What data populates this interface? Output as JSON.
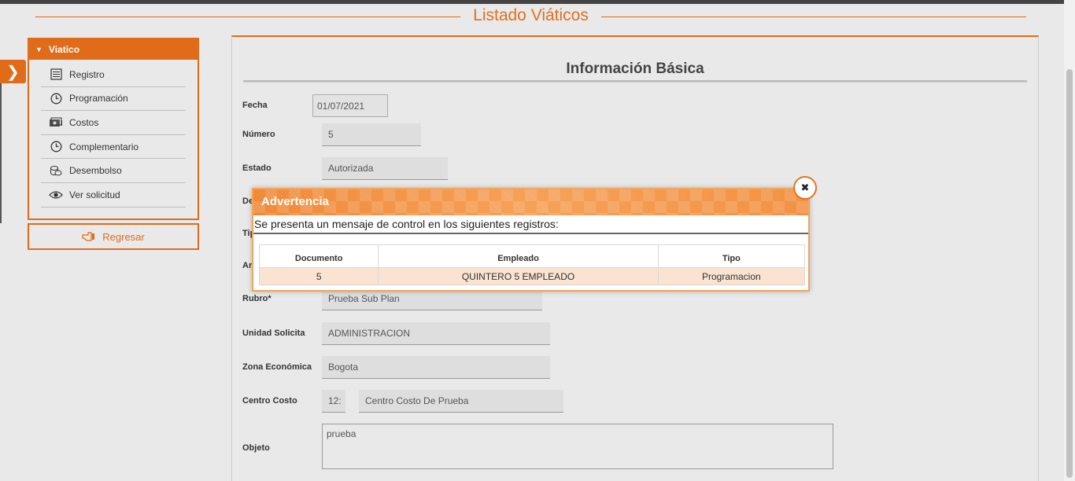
{
  "page": {
    "title": "Listado Viáticos"
  },
  "sidebar": {
    "header": "Viatico",
    "items": [
      {
        "label": "Registro",
        "icon": "list-icon"
      },
      {
        "label": "Programación",
        "icon": "clock-icon"
      },
      {
        "label": "Costos",
        "icon": "money-icon"
      },
      {
        "label": "Complementario",
        "icon": "clock-icon"
      },
      {
        "label": "Desembolso",
        "icon": "coins-icon"
      },
      {
        "label": "Ver solicitud",
        "icon": "eye-icon"
      }
    ],
    "back_label": "Regresar"
  },
  "form": {
    "section_title": "Información Básica",
    "fecha_label": "Fecha",
    "fecha_value": "01/07/2021",
    "numero_label": "Número",
    "numero_value": "5",
    "estado_label": "Estado",
    "estado_value": "Autorizada",
    "de_label_partial": "De",
    "ti_label_partial": "Tip",
    "ar_label_partial": "Ar",
    "rubro_label": "Rubro*",
    "rubro_value": "Prueba Sub Plan",
    "unidad_label": "Unidad Solicita",
    "unidad_value": "ADMINISTRACION",
    "zona_label": "Zona Económica",
    "zona_value": "Bogota",
    "centro_label": "Centro Costo",
    "centro_code": "12:",
    "centro_value": "Centro Costo De Prueba",
    "objeto_label": "Objeto",
    "objeto_value": "prueba"
  },
  "dialog": {
    "title": "Advertencia",
    "message": "Se presenta un mensaje de control en los siguientes registros:",
    "columns": [
      "Documento",
      "Empleado",
      "Tipo"
    ],
    "rows": [
      {
        "documento": "5",
        "empleado": "QUINTERO 5 EMPLEADO",
        "tipo": "Programacion"
      }
    ]
  },
  "colors": {
    "accent": "#e06c1a",
    "dialog_header": "#f39244",
    "row_highlight": "#fbe3d1"
  }
}
